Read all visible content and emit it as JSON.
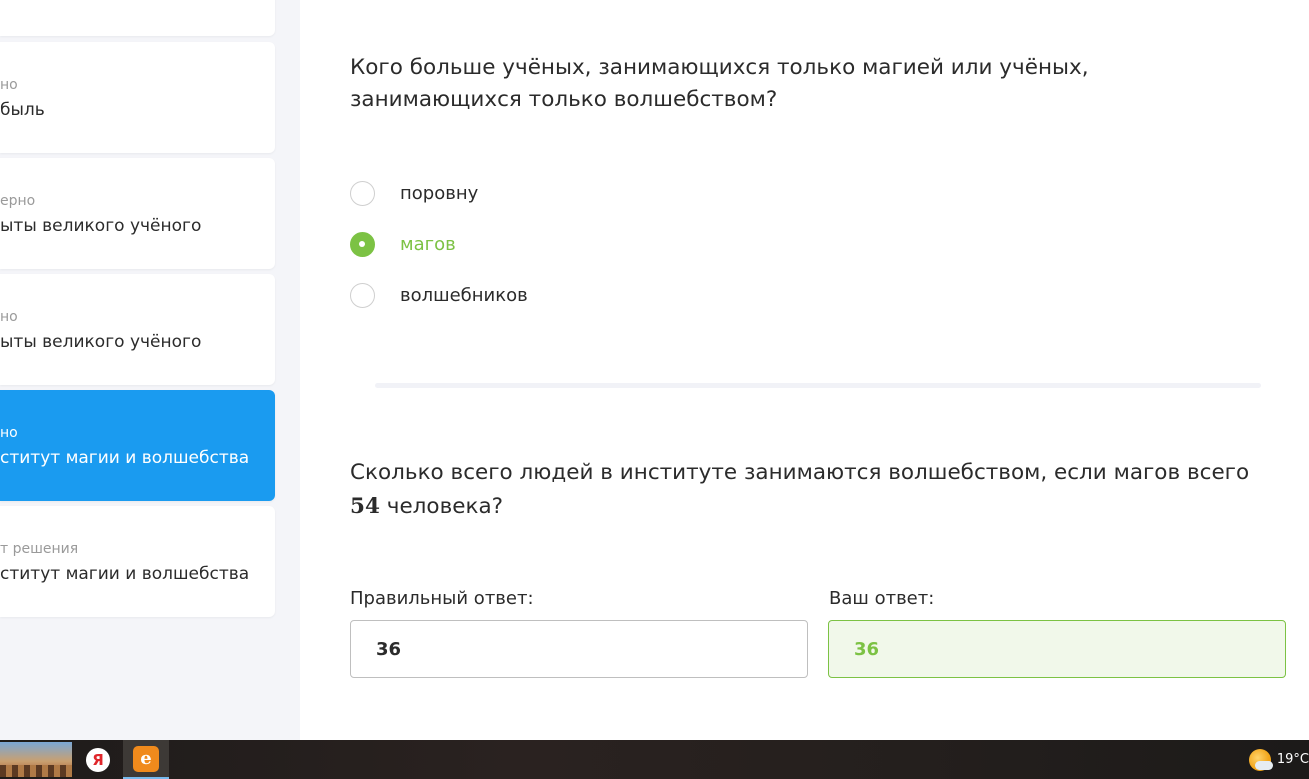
{
  "sidebar": {
    "items": [
      {
        "status": "",
        "title": ""
      },
      {
        "status": "но",
        "title": "быль"
      },
      {
        "status": "ерно",
        "title": "ыты великого учёного"
      },
      {
        "status": "но",
        "title": "ыты великого учёного"
      },
      {
        "status": "но",
        "title": "ститут магии и волшебства"
      },
      {
        "status": "т решения",
        "title": "ститут магии и волшебства"
      }
    ]
  },
  "question1": {
    "text": "Кого больше учёных, занимающихся только магией или учёных, занимающихся только волшебством?",
    "options": [
      {
        "label": "поровну",
        "selected": false
      },
      {
        "label": "магов",
        "selected": true
      },
      {
        "label": "волшебников",
        "selected": false
      }
    ]
  },
  "question2": {
    "text_before": "Сколько всего людей в институте занимаются волшебством, если магов всего ",
    "number": "54",
    "text_after": " человека?",
    "correct_label": "Правильный ответ:",
    "correct_value": "36",
    "user_label": "Ваш ответ:",
    "user_value": "36"
  },
  "colors": {
    "accent_blue": "#1a9bf0",
    "correct_green": "#7cc244"
  },
  "taskbar": {
    "apps": [
      "desktop-thumbnail",
      "yandex-browser-icon",
      "e-app-icon"
    ],
    "yandex_glyph": "Я",
    "e_glyph": "e",
    "weather_temp": "19°C"
  }
}
